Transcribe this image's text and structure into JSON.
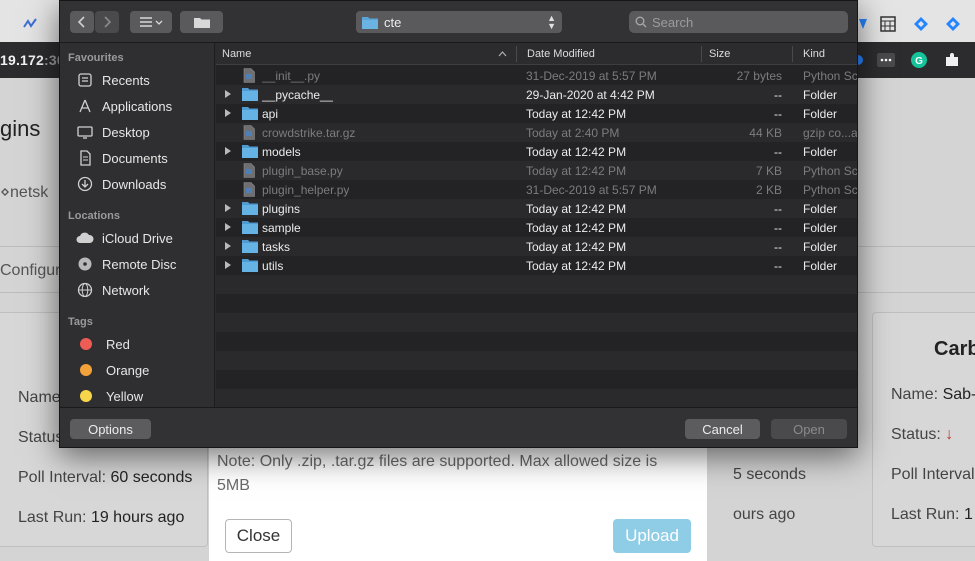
{
  "browser": {
    "address_prefix": "19.172",
    "address_suffix": ":30",
    "extension_icons": [
      {
        "icon": "jira-logo-icon",
        "color": "#2684ff"
      },
      {
        "icon": "calculator-icon",
        "color": "#f0f0f0"
      },
      {
        "icon": "jira-diamond-icon",
        "color": "#2684ff"
      },
      {
        "icon": "jira-diamond-icon-2",
        "color": "#2684ff"
      },
      {
        "icon": "more-dots-icon",
        "color": "#f0f0f0"
      },
      {
        "icon": "grammarly-icon",
        "color": "#15c39a"
      },
      {
        "icon": "puzzle-icon",
        "color": "#f0f0f0"
      }
    ]
  },
  "page": {
    "title": "gins",
    "plugin_name": "netsk",
    "configure_tab": "Configur",
    "left_card": {
      "name_label": "Name",
      "status_label": "Status",
      "poll_interval_label": "Poll Interval:",
      "poll_interval_value": "60 seconds",
      "last_run_label": "Last Run:",
      "last_run_value": "19 hours ago"
    },
    "middle_card": {
      "poll_interval_fragment": "5 seconds",
      "last_run_fragment": "ours ago"
    },
    "right_card": {
      "title": "Carb",
      "name_label": "Name:",
      "name_value": "Sab-",
      "status_label": "Status:",
      "status_arrow": "↓",
      "poll_interval_label": "Poll Interval",
      "last_run_label": "Last Run:",
      "last_run_value": "1"
    },
    "upload_modal": {
      "note": "Note: Only .zip, .tar.gz files are supported. Max allowed size is 5MB",
      "close_label": "Close",
      "upload_label": "Upload"
    }
  },
  "dialog": {
    "current_folder": "cte",
    "search_placeholder": "Search",
    "sidebar": {
      "favourites_label": "Favourites",
      "favourites": [
        {
          "label": "Recents",
          "icon": "clock-icon"
        },
        {
          "label": "Applications",
          "icon": "applications-icon"
        },
        {
          "label": "Desktop",
          "icon": "desktop-icon"
        },
        {
          "label": "Documents",
          "icon": "document-icon"
        },
        {
          "label": "Downloads",
          "icon": "download-icon"
        }
      ],
      "locations_label": "Locations",
      "locations": [
        {
          "label": "iCloud Drive",
          "icon": "cloud-icon"
        },
        {
          "label": "Remote Disc",
          "icon": "disc-icon"
        },
        {
          "label": "Network",
          "icon": "globe-icon"
        }
      ],
      "tags_label": "Tags",
      "tags": [
        {
          "label": "Red",
          "color": "#ee5c55"
        },
        {
          "label": "Orange",
          "color": "#f3a23a"
        },
        {
          "label": "Yellow",
          "color": "#f7d54a"
        }
      ]
    },
    "columns": {
      "name": "Name",
      "date_modified": "Date Modified",
      "size": "Size",
      "kind": "Kind"
    },
    "rows": [
      {
        "name": "__init__.py",
        "type": "file",
        "date": "31-Dec-2019 at 5:57 PM",
        "size": "27 bytes",
        "kind": "Python Sc"
      },
      {
        "name": "__pycache__",
        "type": "folder",
        "date": "29-Jan-2020 at 4:42 PM",
        "size": "--",
        "kind": "Folder"
      },
      {
        "name": "api",
        "type": "folder",
        "date": "Today at 12:42 PM",
        "size": "--",
        "kind": "Folder"
      },
      {
        "name": "crowdstrike.tar.gz",
        "type": "file",
        "date": "Today at 2:40 PM",
        "size": "44 KB",
        "kind": "gzip co...a"
      },
      {
        "name": "models",
        "type": "folder",
        "date": "Today at 12:42 PM",
        "size": "--",
        "kind": "Folder"
      },
      {
        "name": "plugin_base.py",
        "type": "file",
        "date": "Today at 12:42 PM",
        "size": "7 KB",
        "kind": "Python Sc"
      },
      {
        "name": "plugin_helper.py",
        "type": "file",
        "date": "31-Dec-2019 at 5:57 PM",
        "size": "2 KB",
        "kind": "Python Sc"
      },
      {
        "name": "plugins",
        "type": "folder",
        "date": "Today at 12:42 PM",
        "size": "--",
        "kind": "Folder"
      },
      {
        "name": "sample",
        "type": "folder",
        "date": "Today at 12:42 PM",
        "size": "--",
        "kind": "Folder"
      },
      {
        "name": "tasks",
        "type": "folder",
        "date": "Today at 12:42 PM",
        "size": "--",
        "kind": "Folder"
      },
      {
        "name": "utils",
        "type": "folder",
        "date": "Today at 12:42 PM",
        "size": "--",
        "kind": "Folder"
      }
    ],
    "buttons": {
      "options": "Options",
      "cancel": "Cancel",
      "open": "Open"
    },
    "colors": {
      "folder_blue": "#5aa5d8",
      "background": "#2b2b2d"
    }
  }
}
